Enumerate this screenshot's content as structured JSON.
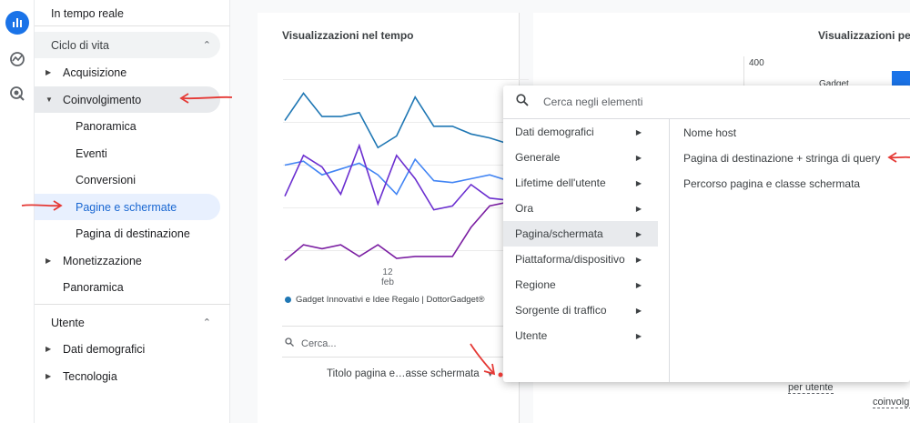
{
  "rail": {
    "icons": [
      "reports-icon",
      "explore-icon",
      "advertising-icon"
    ]
  },
  "sidebar": {
    "top_item": "In tempo reale",
    "lifecycle_header": "Ciclo di vita",
    "acquisition": "Acquisizione",
    "engagement": "Coinvolgimento",
    "engagement_children": [
      "Panoramica",
      "Eventi",
      "Conversioni",
      "Pagine e schermate",
      "Pagina di destinazione"
    ],
    "monetization": "Monetizzazione",
    "overview": "Panoramica",
    "user_header": "Utente",
    "demographics": "Dati demografici",
    "technology": "Tecnologia"
  },
  "main": {
    "chart_title": "Visualizzazioni nel tempo",
    "right_title": "Visualizzazioni per T",
    "right_axis_value": "400",
    "right_bar_label": "Gadget",
    "x_tick_day": "12",
    "x_tick_month": "feb",
    "legend_label": "Gadget Innovativi e Idee Regalo | DottorGadget®",
    "search_placeholder": "Cerca...",
    "dimension_selector": "Titolo pagina e…asse schermata",
    "col_per_utente": "per utente",
    "col_coinvolgimento": "coinvolgi"
  },
  "chart_data": {
    "type": "line",
    "title": "Visualizzazioni nel tempo",
    "xlabel": "",
    "ylabel": "",
    "x_ticks": [
      "12 feb"
    ],
    "legend": [
      "Gadget Innovativi e Idee Regalo | DottorGadget®"
    ],
    "series": [
      {
        "name": "Gadget Innovativi e Idee Regalo | DottorGadget®",
        "color": "#1f77b4",
        "values": [
          58,
          72,
          60,
          60,
          62,
          44,
          50,
          70,
          55,
          55,
          51,
          49,
          46,
          48
        ]
      },
      {
        "color": "#4285f4",
        "values": [
          35,
          37,
          30,
          33,
          36,
          30,
          20,
          38,
          27,
          26,
          28,
          30,
          27,
          23
        ]
      },
      {
        "color": "#6b2fd0",
        "values": [
          19,
          40,
          34,
          20,
          45,
          15,
          40,
          28,
          12,
          14,
          25,
          18,
          17,
          20
        ]
      },
      {
        "color": "#7b1fa2",
        "values": [
          -14,
          -6,
          -8,
          -6,
          -12,
          -6,
          -13,
          -12,
          -12,
          -12,
          3,
          14,
          16,
          11
        ]
      }
    ],
    "colors": {
      "series1": "#1f77b4",
      "series2": "#4285f4",
      "series3": "#6b2fd0",
      "series4": "#7b1fa2"
    }
  },
  "dropdown": {
    "search_placeholder": "Cerca negli elementi",
    "categories": [
      "Dati demografici",
      "Generale",
      "Lifetime dell'utente",
      "Ora",
      "Pagina/schermata",
      "Piattaforma/dispositivo",
      "Regione",
      "Sorgente di traffico",
      "Utente"
    ],
    "selected_category": "Pagina/schermata",
    "options": [
      "Nome host",
      "Pagina di destinazione + stringa di query",
      "Percorso pagina e classe schermata"
    ]
  },
  "colors": {
    "accent": "#1a73e8",
    "annotation_red": "#e53935"
  }
}
